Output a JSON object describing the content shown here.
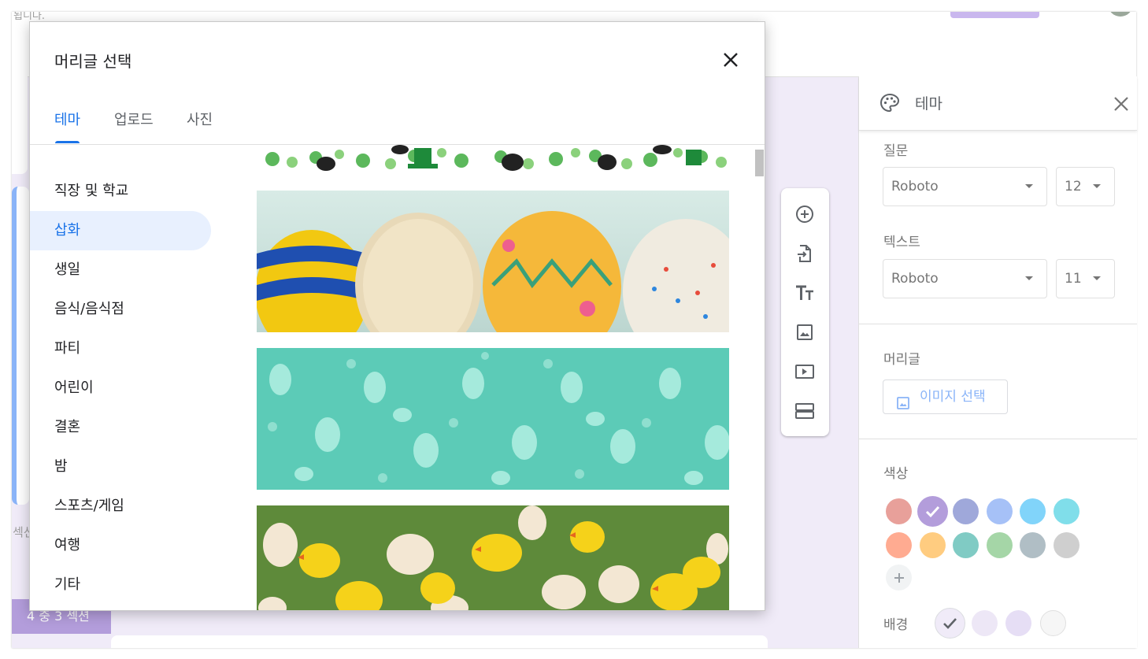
{
  "background": {
    "header_text": "됩니다.",
    "section_text": "섹션",
    "section_badge": "4 중 3 섹션"
  },
  "toolbar": {
    "items": [
      "add-question-icon",
      "import-questions-icon",
      "add-title-icon",
      "add-image-icon",
      "add-video-icon",
      "add-section-icon"
    ]
  },
  "theme_panel": {
    "title": "테마",
    "question_label": "질문",
    "question_font": "Roboto",
    "question_size": "12",
    "text_label": "텍스트",
    "text_font": "Roboto",
    "text_size": "11",
    "header_label": "머리글",
    "image_button": "이미지 선택",
    "color_label": "색상",
    "colors": [
      "#e8a09a",
      "#b39ddb",
      "#9fa8da",
      "#a6c1f7",
      "#81d4fa",
      "#80deea",
      "#ffab91",
      "#ffcc80",
      "#80cbc4",
      "#a5d6a7",
      "#b0bec5",
      "#cfcfcf"
    ],
    "selected_color": "#b39ddb",
    "background_label": "배경",
    "background_colors": [
      "#f0ebf8",
      "#ede7f6",
      "#e6def5",
      "#f6f6f6"
    ]
  },
  "dialog": {
    "title": "머리글 선택",
    "tabs": [
      "테마",
      "업로드",
      "사진"
    ],
    "active_tab": "테마",
    "categories": [
      "직장 및 학교",
      "삽화",
      "생일",
      "음식/음식점",
      "파티",
      "어린이",
      "결혼",
      "밤",
      "스포츠/게임",
      "여행",
      "기타"
    ],
    "active_category": "삽화",
    "images": [
      "st-patricks-clover-pattern",
      "easter-painted-eggs",
      "easter-bunny-pattern",
      "chicks-and-eggs"
    ]
  }
}
